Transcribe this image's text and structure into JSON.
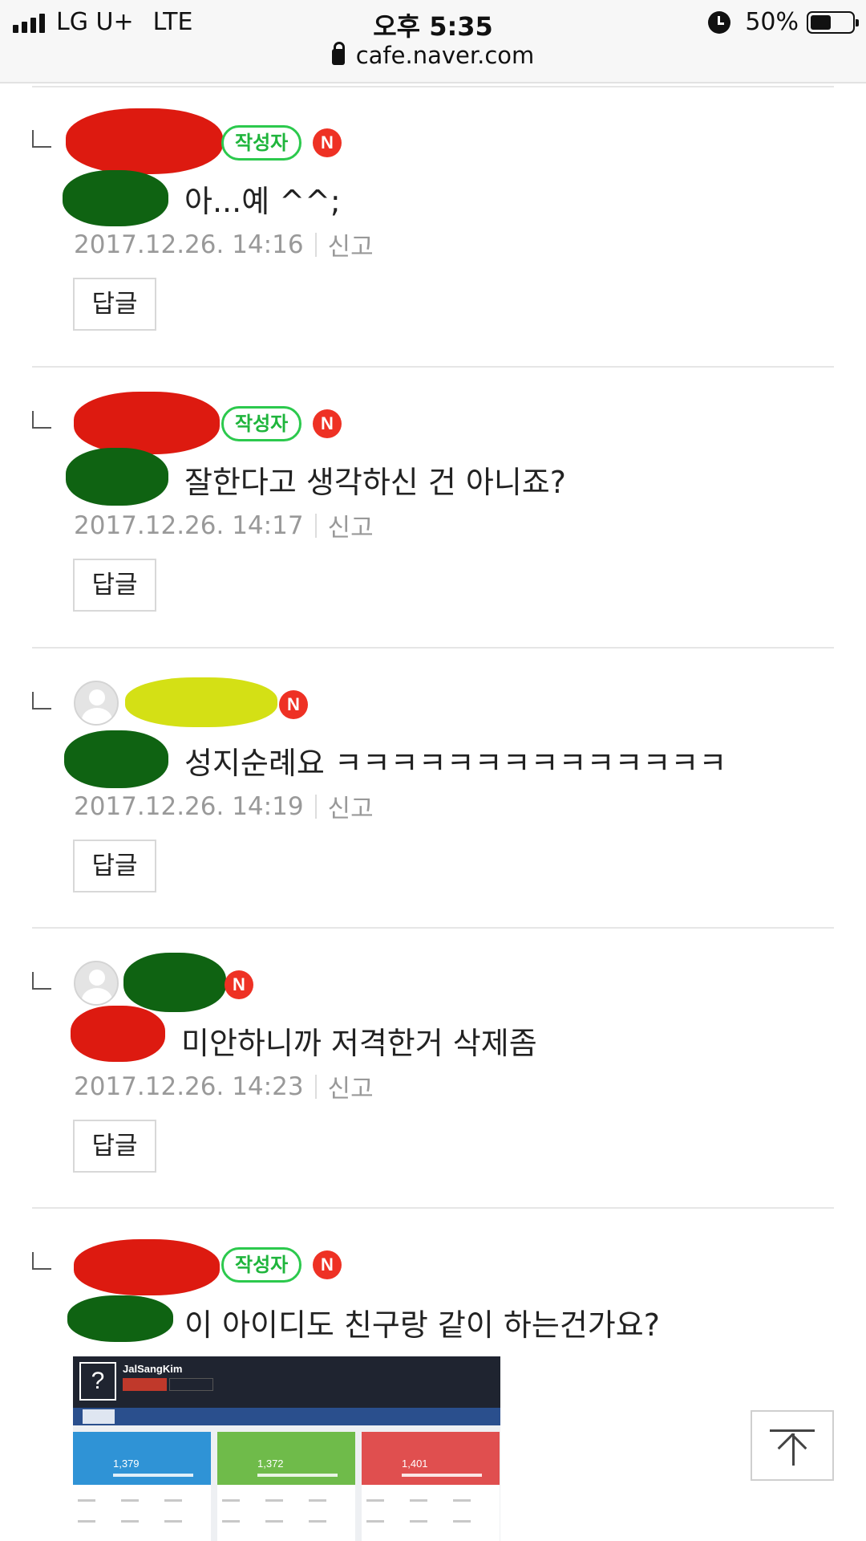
{
  "status_bar": {
    "carrier": "LG U+",
    "network": "LTE",
    "time": "오후 5:35",
    "battery": "50%",
    "battery_level": 0.5
  },
  "url": "cafe.naver.com",
  "reply_button_label": "답글",
  "report_label": "신고",
  "author_badge": "작성자",
  "new_badge": "N",
  "comments": [
    {
      "text": "아...예 ^^;",
      "date": "2017.12.26. 14:16",
      "is_author": true
    },
    {
      "text": "잘한다고 생각하신 건 아니죠?",
      "date": "2017.12.26. 14:17",
      "is_author": true
    },
    {
      "text": "성지순례요 ㅋㅋㅋㅋㅋㅋㅋㅋㅋㅋㅋㅋㅋㅋ",
      "date": "2017.12.26. 14:19",
      "is_author": false
    },
    {
      "text": "미안하니까 저격한거 삭제좀",
      "date": "2017.12.26. 14:23",
      "is_author": false
    },
    {
      "text": "이 아이디도 친구랑 같이 하는건가요?",
      "is_author": true
    }
  ],
  "embedded_image": {
    "player_name": "JalSangKim",
    "cards": [
      {
        "rating": "1,379",
        "color": "#2f93d6"
      },
      {
        "rating": "1,372",
        "color": "#6fbb4a"
      },
      {
        "rating": "1,401",
        "color": "#e04f4f"
      }
    ]
  },
  "colors": {
    "author_badge": "#2cc94d",
    "new_badge": "#ee3124",
    "redaction_red": "#dd1a10",
    "redaction_green": "#0f6312",
    "redaction_yellow": "#d4e015"
  }
}
